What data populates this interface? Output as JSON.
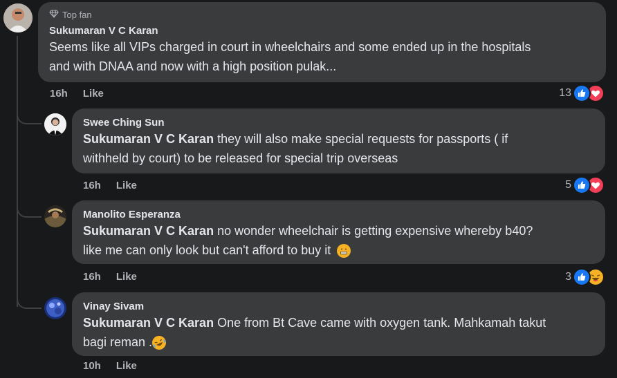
{
  "comments": [
    {
      "badge": "Top fan",
      "author": "Sukumaran V C Karan",
      "line1": "Seems like all VIPs charged in court in wheelchairs and some ended up in the hospitals",
      "line2": "and with DNAA and now with a high position pulak...",
      "time": "16h",
      "like_label": "Like",
      "reaction_count": "13",
      "reactions": [
        "like-icon",
        "heart-icon"
      ]
    }
  ],
  "replies": [
    {
      "author": "Swee Ching Sun",
      "mention": "Sukumaran V C Karan",
      "line1": " they will also make special requests for passports ( if",
      "line2": "withheld by court) to be released for special trip overseas",
      "time": "16h",
      "like_label": "Like",
      "reaction_count": "5",
      "reactions": [
        "like-icon",
        "heart-icon"
      ]
    },
    {
      "author": "Manolito Esperanza",
      "mention": "Sukumaran V C Karan",
      "line1": " no wonder wheelchair is getting expensive whereby b40?",
      "line2": "like me can only look but can't afford to buy it",
      "emoji": "grimacing-face-icon",
      "time": "16h",
      "like_label": "Like",
      "reaction_count": "3",
      "reactions": [
        "like-icon",
        "haha-icon"
      ]
    },
    {
      "author": "Vinay Sivam",
      "mention": "Sukumaran V C Karan",
      "line1": " One from Bt Cave came with oxygen tank. Mahkamah takut",
      "line2": "bagi reman .",
      "emoji": "rofl-face-icon",
      "time": "10h",
      "like_label": "Like"
    }
  ],
  "colors": {
    "background": "#18191a",
    "bubble": "#3a3b3c",
    "text": "#e4e6eb",
    "secondary": "#b0b3b8",
    "like_blue": "#1877f2",
    "love_red": "#f33e58",
    "haha_yellow": "#f7b125"
  }
}
